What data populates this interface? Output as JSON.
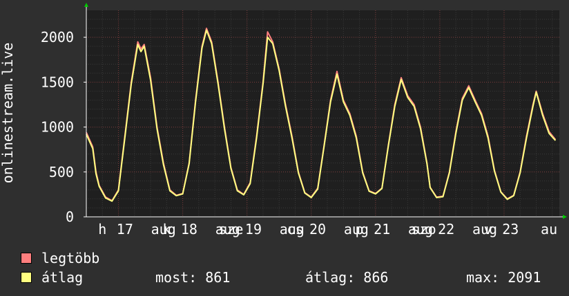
{
  "colors": {
    "background": "#2f2f2f",
    "plot_background": "#1f1f1f",
    "grid": "#7a3a3a",
    "axis_text": "#ffffff",
    "max_series": "#ff7f7f",
    "avg_series": "#ffff80",
    "arrow": "#00cc00"
  },
  "chart_data": {
    "type": "line",
    "ylabel": "onlinestream.live",
    "ylim": [
      0,
      2300
    ],
    "yticks": [
      0,
      500,
      1000,
      1500,
      2000
    ],
    "xlim": [
      0,
      7.36
    ],
    "xticks": [
      {
        "x": 0.25,
        "label": "h"
      },
      {
        "x": 0.6,
        "label": "17"
      },
      {
        "x": 1.2,
        "label": "aug"
      },
      {
        "x": 1.25,
        "label": "k"
      },
      {
        "x": 1.6,
        "label": "18"
      },
      {
        "x": 2.2,
        "label": "aug"
      },
      {
        "x": 2.25,
        "label": "sze"
      },
      {
        "x": 2.6,
        "label": "19"
      },
      {
        "x": 3.2,
        "label": "aug"
      },
      {
        "x": 3.25,
        "label": "cs"
      },
      {
        "x": 3.6,
        "label": "20"
      },
      {
        "x": 4.2,
        "label": "aug"
      },
      {
        "x": 4.25,
        "label": "p"
      },
      {
        "x": 4.6,
        "label": "21"
      },
      {
        "x": 5.2,
        "label": "aug"
      },
      {
        "x": 5.25,
        "label": "szo"
      },
      {
        "x": 5.6,
        "label": "22"
      },
      {
        "x": 6.2,
        "label": "aug"
      },
      {
        "x": 6.25,
        "label": "v"
      },
      {
        "x": 6.6,
        "label": "23"
      },
      {
        "x": 7.2,
        "label": "au"
      }
    ],
    "series": [
      {
        "name": "legtöbb",
        "color": "#ff7f7f",
        "points": [
          [
            0,
            940
          ],
          [
            0.1,
            780
          ],
          [
            0.15,
            500
          ],
          [
            0.2,
            350
          ],
          [
            0.3,
            220
          ],
          [
            0.4,
            180
          ],
          [
            0.5,
            300
          ],
          [
            0.6,
            900
          ],
          [
            0.7,
            1500
          ],
          [
            0.8,
            1950
          ],
          [
            0.85,
            1870
          ],
          [
            0.9,
            1920
          ],
          [
            1.0,
            1550
          ],
          [
            1.1,
            1000
          ],
          [
            1.2,
            600
          ],
          [
            1.3,
            300
          ],
          [
            1.4,
            240
          ],
          [
            1.5,
            260
          ],
          [
            1.6,
            600
          ],
          [
            1.7,
            1300
          ],
          [
            1.8,
            1900
          ],
          [
            1.87,
            2100
          ],
          [
            1.95,
            1950
          ],
          [
            2.05,
            1500
          ],
          [
            2.15,
            1000
          ],
          [
            2.25,
            550
          ],
          [
            2.35,
            300
          ],
          [
            2.45,
            250
          ],
          [
            2.55,
            380
          ],
          [
            2.65,
            900
          ],
          [
            2.75,
            1500
          ],
          [
            2.82,
            2060
          ],
          [
            2.9,
            1950
          ],
          [
            3.0,
            1650
          ],
          [
            3.1,
            1250
          ],
          [
            3.2,
            900
          ],
          [
            3.3,
            500
          ],
          [
            3.4,
            270
          ],
          [
            3.5,
            220
          ],
          [
            3.6,
            320
          ],
          [
            3.7,
            800
          ],
          [
            3.8,
            1300
          ],
          [
            3.9,
            1620
          ],
          [
            4.0,
            1300
          ],
          [
            4.1,
            1150
          ],
          [
            4.2,
            900
          ],
          [
            4.3,
            500
          ],
          [
            4.4,
            290
          ],
          [
            4.5,
            260
          ],
          [
            4.6,
            320
          ],
          [
            4.7,
            800
          ],
          [
            4.8,
            1250
          ],
          [
            4.9,
            1550
          ],
          [
            5.0,
            1350
          ],
          [
            5.1,
            1250
          ],
          [
            5.2,
            1000
          ],
          [
            5.3,
            600
          ],
          [
            5.35,
            330
          ],
          [
            5.45,
            220
          ],
          [
            5.55,
            230
          ],
          [
            5.65,
            500
          ],
          [
            5.75,
            950
          ],
          [
            5.85,
            1320
          ],
          [
            5.95,
            1460
          ],
          [
            6.05,
            1300
          ],
          [
            6.15,
            1150
          ],
          [
            6.25,
            900
          ],
          [
            6.35,
            520
          ],
          [
            6.45,
            280
          ],
          [
            6.55,
            200
          ],
          [
            6.65,
            240
          ],
          [
            6.75,
            500
          ],
          [
            6.85,
            900
          ],
          [
            6.95,
            1250
          ],
          [
            7.0,
            1400
          ],
          [
            7.1,
            1150
          ],
          [
            7.2,
            950
          ],
          [
            7.3,
            860
          ]
        ]
      },
      {
        "name": "átlag",
        "color": "#ffff80",
        "points": [
          [
            0,
            920
          ],
          [
            0.1,
            760
          ],
          [
            0.15,
            480
          ],
          [
            0.2,
            340
          ],
          [
            0.3,
            210
          ],
          [
            0.4,
            175
          ],
          [
            0.5,
            290
          ],
          [
            0.6,
            880
          ],
          [
            0.7,
            1480
          ],
          [
            0.8,
            1920
          ],
          [
            0.85,
            1840
          ],
          [
            0.9,
            1900
          ],
          [
            1.0,
            1520
          ],
          [
            1.1,
            980
          ],
          [
            1.2,
            580
          ],
          [
            1.3,
            290
          ],
          [
            1.4,
            235
          ],
          [
            1.5,
            255
          ],
          [
            1.6,
            590
          ],
          [
            1.7,
            1280
          ],
          [
            1.8,
            1880
          ],
          [
            1.87,
            2080
          ],
          [
            1.95,
            1930
          ],
          [
            2.05,
            1480
          ],
          [
            2.15,
            980
          ],
          [
            2.25,
            540
          ],
          [
            2.35,
            290
          ],
          [
            2.45,
            245
          ],
          [
            2.55,
            370
          ],
          [
            2.65,
            880
          ],
          [
            2.75,
            1480
          ],
          [
            2.82,
            2000
          ],
          [
            2.9,
            1930
          ],
          [
            3.0,
            1630
          ],
          [
            3.1,
            1230
          ],
          [
            3.2,
            880
          ],
          [
            3.3,
            490
          ],
          [
            3.4,
            265
          ],
          [
            3.5,
            215
          ],
          [
            3.6,
            310
          ],
          [
            3.7,
            790
          ],
          [
            3.8,
            1280
          ],
          [
            3.9,
            1590
          ],
          [
            4.0,
            1280
          ],
          [
            4.1,
            1130
          ],
          [
            4.2,
            880
          ],
          [
            4.3,
            490
          ],
          [
            4.4,
            285
          ],
          [
            4.5,
            255
          ],
          [
            4.6,
            315
          ],
          [
            4.7,
            790
          ],
          [
            4.8,
            1230
          ],
          [
            4.9,
            1530
          ],
          [
            5.0,
            1330
          ],
          [
            5.1,
            1230
          ],
          [
            5.2,
            980
          ],
          [
            5.3,
            590
          ],
          [
            5.35,
            325
          ],
          [
            5.45,
            215
          ],
          [
            5.55,
            225
          ],
          [
            5.65,
            490
          ],
          [
            5.75,
            930
          ],
          [
            5.85,
            1300
          ],
          [
            5.95,
            1440
          ],
          [
            6.05,
            1280
          ],
          [
            6.15,
            1130
          ],
          [
            6.25,
            880
          ],
          [
            6.35,
            510
          ],
          [
            6.45,
            275
          ],
          [
            6.55,
            195
          ],
          [
            6.65,
            235
          ],
          [
            6.75,
            490
          ],
          [
            6.85,
            880
          ],
          [
            6.95,
            1230
          ],
          [
            7.0,
            1390
          ],
          [
            7.1,
            1130
          ],
          [
            7.2,
            930
          ],
          [
            7.3,
            850
          ]
        ]
      }
    ],
    "legend": [
      {
        "label": "legtöbb",
        "color": "#ff7f7f"
      },
      {
        "label": "átlag",
        "color": "#ffff80"
      }
    ],
    "grid": true,
    "legend_position": "bottom-left"
  },
  "stats": {
    "most": "most: 861",
    "atlag": "átlag: 866",
    "max": "max: 2091"
  }
}
